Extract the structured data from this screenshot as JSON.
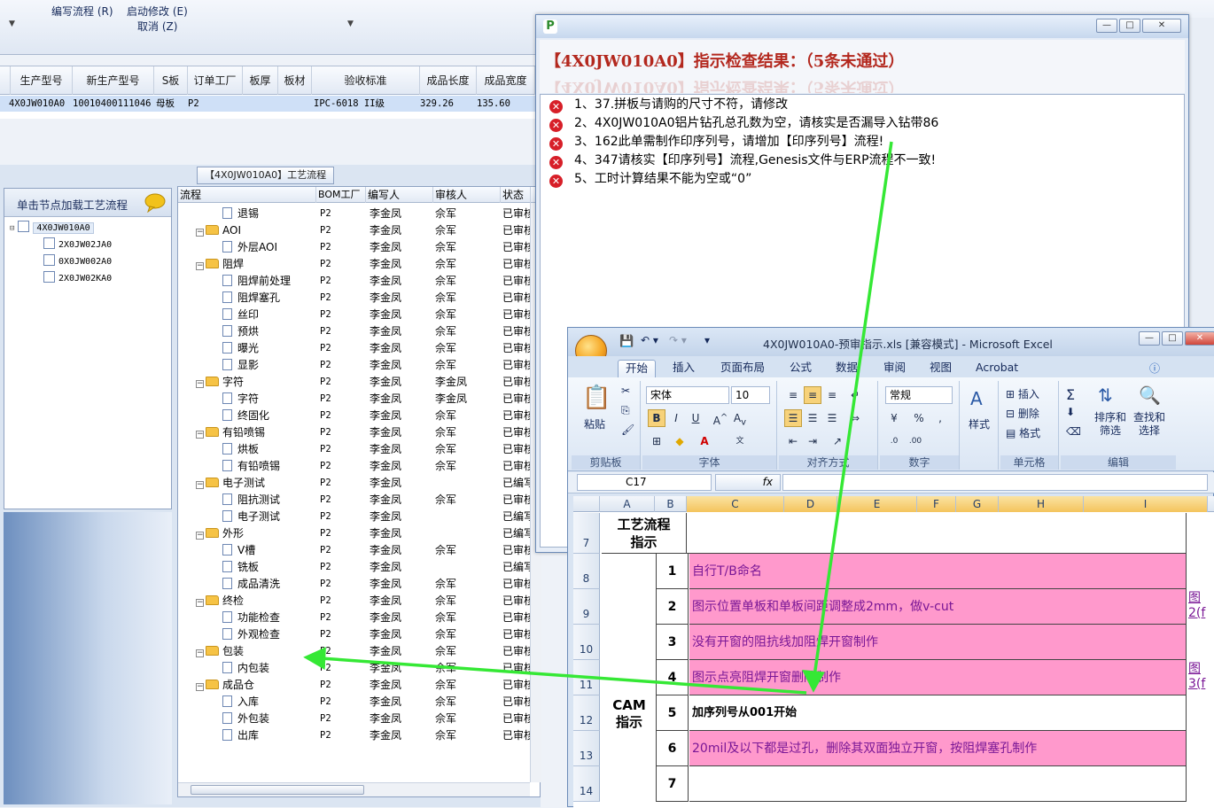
{
  "menu": {
    "edit_flow": "编写流程 (R)",
    "start_modify": "启动修改 (E)",
    "cancel": "取消 (Z)"
  },
  "main_grid": {
    "headers": [
      "生产型号",
      "新生产型号",
      "S板",
      "订单工厂",
      "板厚",
      "板材",
      "验收标准",
      "成品长度",
      "成品宽度"
    ],
    "row": [
      "4X0JW010A0",
      "10010400111046",
      "母板",
      "P2",
      "",
      "",
      "IPC-6018 II级",
      "329.26",
      "135.60"
    ]
  },
  "flow_tab": "【4X0JW010A0】工艺流程",
  "left_panel": {
    "title": "单击节点加载工艺流程",
    "nodes": [
      "4X0JW010A0",
      "2X0JW02JA0",
      "0X0JW002A0",
      "2X0JW02KA0"
    ]
  },
  "flow_panel": {
    "headers": [
      "流程",
      "BOM工厂",
      "编写人",
      "审核人",
      "状态"
    ],
    "rows": [
      {
        "level": 1,
        "type": "doc",
        "name": "退锡",
        "bom": "P2",
        "writer": "李金凤",
        "reviewer": "佘军",
        "status": "已审核"
      },
      {
        "level": 0,
        "type": "folder",
        "name": "AOI",
        "bom": "P2",
        "writer": "李金凤",
        "reviewer": "佘军",
        "status": "已审核"
      },
      {
        "level": 1,
        "type": "doc",
        "name": "外层AOI",
        "bom": "P2",
        "writer": "李金凤",
        "reviewer": "佘军",
        "status": "已审核"
      },
      {
        "level": 0,
        "type": "folder",
        "name": "阻焊",
        "bom": "P2",
        "writer": "李金凤",
        "reviewer": "佘军",
        "status": "已审核"
      },
      {
        "level": 1,
        "type": "doc",
        "name": "阻焊前处理",
        "bom": "P2",
        "writer": "李金凤",
        "reviewer": "佘军",
        "status": "已审核"
      },
      {
        "level": 1,
        "type": "doc",
        "name": "阻焊塞孔",
        "bom": "P2",
        "writer": "李金凤",
        "reviewer": "佘军",
        "status": "已审核"
      },
      {
        "level": 1,
        "type": "doc",
        "name": "丝印",
        "bom": "P2",
        "writer": "李金凤",
        "reviewer": "佘军",
        "status": "已审核"
      },
      {
        "level": 1,
        "type": "doc",
        "name": "预烘",
        "bom": "P2",
        "writer": "李金凤",
        "reviewer": "佘军",
        "status": "已审核"
      },
      {
        "level": 1,
        "type": "doc",
        "name": "曝光",
        "bom": "P2",
        "writer": "李金凤",
        "reviewer": "佘军",
        "status": "已审核"
      },
      {
        "level": 1,
        "type": "doc",
        "name": "显影",
        "bom": "P2",
        "writer": "李金凤",
        "reviewer": "佘军",
        "status": "已审核"
      },
      {
        "level": 0,
        "type": "folder",
        "name": "字符",
        "bom": "P2",
        "writer": "李金凤",
        "reviewer": "李金凤",
        "status": "已审核"
      },
      {
        "level": 1,
        "type": "doc",
        "name": "字符",
        "bom": "P2",
        "writer": "李金凤",
        "reviewer": "李金凤",
        "status": "已审核"
      },
      {
        "level": 1,
        "type": "doc",
        "name": "终固化",
        "bom": "P2",
        "writer": "李金凤",
        "reviewer": "佘军",
        "status": "已审核"
      },
      {
        "level": 0,
        "type": "folder",
        "name": "有铅喷锡",
        "bom": "P2",
        "writer": "李金凤",
        "reviewer": "佘军",
        "status": "已审核"
      },
      {
        "level": 1,
        "type": "doc",
        "name": "烘板",
        "bom": "P2",
        "writer": "李金凤",
        "reviewer": "佘军",
        "status": "已审核"
      },
      {
        "level": 1,
        "type": "doc",
        "name": "有铅喷锡",
        "bom": "P2",
        "writer": "李金凤",
        "reviewer": "佘军",
        "status": "已审核"
      },
      {
        "level": 0,
        "type": "folder",
        "name": "电子测试",
        "bom": "P2",
        "writer": "李金凤",
        "reviewer": "",
        "status": "已编写"
      },
      {
        "level": 1,
        "type": "doc",
        "name": "阻抗测试",
        "bom": "P2",
        "writer": "李金凤",
        "reviewer": "佘军",
        "status": "已审核"
      },
      {
        "level": 1,
        "type": "doc",
        "name": "电子测试",
        "bom": "P2",
        "writer": "李金凤",
        "reviewer": "",
        "status": "已编写"
      },
      {
        "level": 0,
        "type": "folder",
        "name": "外形",
        "bom": "P2",
        "writer": "李金凤",
        "reviewer": "",
        "status": "已编写"
      },
      {
        "level": 1,
        "type": "doc",
        "name": "V槽",
        "bom": "P2",
        "writer": "李金凤",
        "reviewer": "佘军",
        "status": "已审核"
      },
      {
        "level": 1,
        "type": "doc",
        "name": "铣板",
        "bom": "P2",
        "writer": "李金凤",
        "reviewer": "",
        "status": "已编写"
      },
      {
        "level": 1,
        "type": "doc",
        "name": "成品清洗",
        "bom": "P2",
        "writer": "李金凤",
        "reviewer": "佘军",
        "status": "已审核"
      },
      {
        "level": 0,
        "type": "folder",
        "name": "终检",
        "bom": "P2",
        "writer": "李金凤",
        "reviewer": "佘军",
        "status": "已审核"
      },
      {
        "level": 1,
        "type": "doc",
        "name": "功能检查",
        "bom": "P2",
        "writer": "李金凤",
        "reviewer": "佘军",
        "status": "已审核"
      },
      {
        "level": 1,
        "type": "doc",
        "name": "外观检查",
        "bom": "P2",
        "writer": "李金凤",
        "reviewer": "佘军",
        "status": "已审核"
      },
      {
        "level": 0,
        "type": "folder",
        "name": "包装",
        "bom": "P2",
        "writer": "李金凤",
        "reviewer": "佘军",
        "status": "已审核"
      },
      {
        "level": 1,
        "type": "doc",
        "name": "内包装",
        "bom": "P2",
        "writer": "李金凤",
        "reviewer": "佘军",
        "status": "已审核"
      },
      {
        "level": 0,
        "type": "folder",
        "name": "成品仓",
        "bom": "P2",
        "writer": "李金凤",
        "reviewer": "佘军",
        "status": "已审核"
      },
      {
        "level": 1,
        "type": "doc",
        "name": "入库",
        "bom": "P2",
        "writer": "李金凤",
        "reviewer": "佘军",
        "status": "已审核"
      },
      {
        "level": 1,
        "type": "doc",
        "name": "外包装",
        "bom": "P2",
        "writer": "李金凤",
        "reviewer": "佘军",
        "status": "已审核"
      },
      {
        "level": 1,
        "type": "doc",
        "name": "出库",
        "bom": "P2",
        "writer": "李金凤",
        "reviewer": "佘军",
        "status": "已审核"
      }
    ]
  },
  "check_window": {
    "heading": "【4X0JW010A0】指示检查结果：（5条未通过）",
    "items": [
      "1、37.拼板与请购的尺寸不符，请修改",
      "2、4X0JW010A0铝片钻孔总孔数为空，请核实是否漏导入钻带86",
      "3、162此单需制作印序列号，请增加【印序列号】流程!",
      "4、347请核实【印序列号】流程,Genesis文件与ERP流程不一致!",
      "5、工时计算结果不能为空或“0”"
    ]
  },
  "excel": {
    "title": "4X0JW010A0-预审指示.xls [兼容模式] - Microsoft Excel",
    "tabs": [
      "开始",
      "插入",
      "页面布局",
      "公式",
      "数据",
      "审阅",
      "视图",
      "Acrobat"
    ],
    "ribbon": {
      "paste": "粘贴",
      "font_name": "宋体",
      "font_size": "10",
      "number_format": "常规",
      "styles": "样式",
      "insert": "插入",
      "delete": "删除",
      "format": "格式",
      "sort_filter": "排序和\n筛选",
      "find_select": "查找和\n选择",
      "groups": [
        "剪贴板",
        "字体",
        "对齐方式",
        "数字",
        "单元格",
        "编辑"
      ]
    },
    "name_box": "C17",
    "fx": "fx",
    "columns": [
      "A",
      "B",
      "C",
      "D",
      "E",
      "F",
      "G",
      "H",
      "I"
    ],
    "row_numbers": [
      "7",
      "8",
      "9",
      "10",
      "11",
      "12",
      "13",
      "14"
    ],
    "header_label": "工艺流程\n指示",
    "cam_label": "CAM\n指示",
    "instructions": [
      {
        "no": "1",
        "text": "自行T/B命名",
        "pink": true,
        "link": ""
      },
      {
        "no": "2",
        "text": "图示位置单板和单板间距调整成2mm，做v-cut",
        "pink": true,
        "link": "图\n2(f"
      },
      {
        "no": "3",
        "text": "没有开窗的阻抗线加阻焊开窗制作",
        "pink": true,
        "link": ""
      },
      {
        "no": "4",
        "text": "图示点亮阻焊开窗删除制作",
        "pink": true,
        "link": "图\n3(f"
      },
      {
        "no": "5",
        "text": "加序列号从001开始",
        "pink": false,
        "link": ""
      },
      {
        "no": "6",
        "text": "20mil及以下都是过孔，删除其双面独立开窗，按阻焊塞孔制作",
        "pink": true,
        "link": ""
      },
      {
        "no": "7",
        "text": "",
        "pink": false,
        "link": ""
      }
    ]
  },
  "colors": {
    "heading_red": "#b3281e",
    "pink_fill": "#ff99cc",
    "arrow_green": "#35e835"
  }
}
